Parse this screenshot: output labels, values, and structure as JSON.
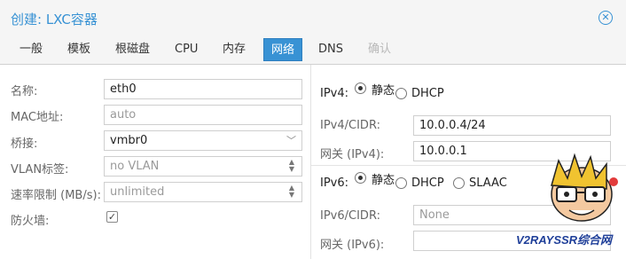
{
  "window": {
    "title": "创建: LXC容器"
  },
  "tabs": [
    {
      "label": "一般"
    },
    {
      "label": "模板"
    },
    {
      "label": "根磁盘"
    },
    {
      "label": "CPU"
    },
    {
      "label": "内存"
    },
    {
      "label": "网络"
    },
    {
      "label": "DNS"
    },
    {
      "label": "确认"
    }
  ],
  "active_tab": "网络",
  "left": {
    "name": {
      "label": "名称:",
      "value": "eth0"
    },
    "mac": {
      "label": "MAC地址:",
      "value": "auto"
    },
    "bridge": {
      "label": "桥接:",
      "value": "vmbr0"
    },
    "vlan": {
      "label": "VLAN标签:",
      "value": "no VLAN"
    },
    "rate": {
      "label": "速率限制 (MB/s):",
      "value": "unlimited"
    },
    "firewall": {
      "label": "防火墙:",
      "checked": true,
      "glyph": "✓"
    }
  },
  "right": {
    "ipv4": {
      "label": "IPv4:",
      "opt_static": "静态",
      "opt_dhcp": "DHCP",
      "selected": "静态"
    },
    "ipv4_cidr": {
      "label": "IPv4/CIDR:",
      "value": "10.0.0.4/24"
    },
    "gw4": {
      "label": "网关 (IPv4):",
      "value": "10.0.0.1"
    },
    "ipv6": {
      "label": "IPv6:",
      "opt_static": "静态",
      "opt_dhcp": "DHCP",
      "opt_slaac": "SLAAC",
      "selected": "静态"
    },
    "ipv6_cidr": {
      "label": "IPv6/CIDR:",
      "placeholder": "None"
    },
    "gw6": {
      "label": "网关 (IPv6):",
      "value": ""
    }
  },
  "watermark": {
    "text": "V2RAYSSR综合网"
  },
  "colors": {
    "accent": "#3892d4",
    "disabled": "#b8b8b8"
  }
}
